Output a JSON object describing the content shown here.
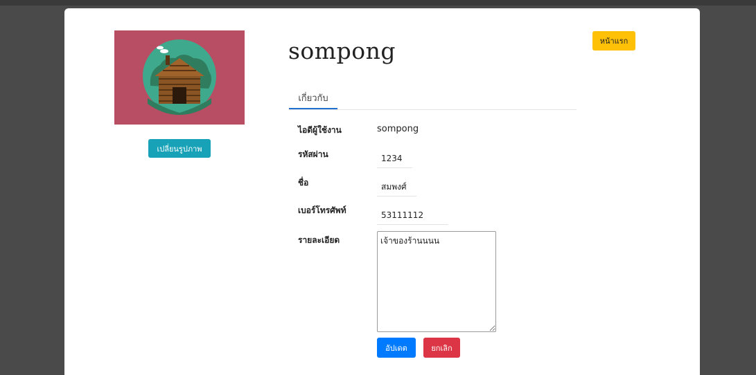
{
  "profile": {
    "username": "sompong",
    "change_photo_label": "เปลี่ยนรูปภาพ"
  },
  "nav": {
    "home_label": "หน้าแรก"
  },
  "tabs": {
    "about_label": "เกี่ยวกับ"
  },
  "form": {
    "user_id_label": "ไอดีผู้ใช้งาน",
    "user_id_value": "sompong",
    "password_label": "รหัสผ่าน",
    "password_value": "1234",
    "name_label": "ชื่อ",
    "name_value": "สมพงศ์",
    "phone_label": "เบอร์โทรศัพท์",
    "phone_value": "53111112",
    "details_label": "รายละเอียด",
    "details_value": "เจ้าของร้านนนน",
    "update_label": "อัปเดต",
    "cancel_label": "ยกเลิก"
  },
  "colors": {
    "avatar_bg": "#b84e63",
    "change_button": "#17a2b8",
    "home_button": "#ffc107",
    "update_button": "#007bff",
    "cancel_button": "#dc3545",
    "tab_active": "#1e6fd0"
  },
  "icons": {
    "avatar": "log-cabin-icon"
  }
}
